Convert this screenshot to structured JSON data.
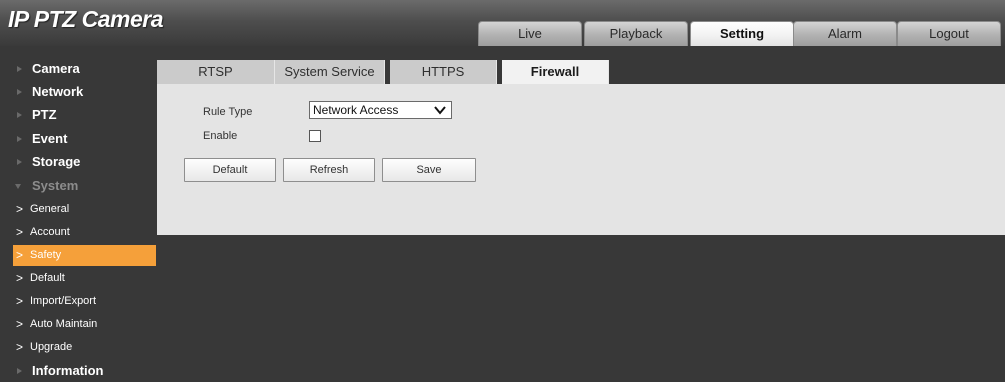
{
  "app": {
    "title": "IP PTZ Camera"
  },
  "top_tabs": [
    {
      "label": "Live",
      "active": false
    },
    {
      "label": "Playback",
      "active": false
    },
    {
      "label": "Setting",
      "active": true
    },
    {
      "label": "Alarm",
      "active": false
    },
    {
      "label": "Logout",
      "active": false
    }
  ],
  "sidebar": {
    "items": [
      {
        "label": "Camera",
        "icon": "triangle-right-icon"
      },
      {
        "label": "Network",
        "icon": "triangle-right-icon"
      },
      {
        "label": "PTZ",
        "icon": "triangle-right-icon"
      },
      {
        "label": "Event",
        "icon": "triangle-right-icon"
      },
      {
        "label": "Storage",
        "icon": "triangle-right-icon"
      },
      {
        "label": "System",
        "icon": "triangle-down-icon",
        "expanded": true
      },
      {
        "label": "Information",
        "icon": "triangle-right-icon"
      }
    ],
    "system_children": [
      {
        "label": "General",
        "active": false
      },
      {
        "label": "Account",
        "active": false
      },
      {
        "label": "Safety",
        "active": true
      },
      {
        "label": "Default",
        "active": false
      },
      {
        "label": "Import/Export",
        "active": false
      },
      {
        "label": "Auto Maintain",
        "active": false
      },
      {
        "label": "Upgrade",
        "active": false
      }
    ]
  },
  "sub_tabs": [
    {
      "label": "RTSP Authentication",
      "active": false
    },
    {
      "label": "System Service",
      "active": false
    },
    {
      "label": "HTTPS",
      "active": false
    },
    {
      "label": "Firewall",
      "active": true
    }
  ],
  "form": {
    "rule_type_label": "Rule Type",
    "rule_type_value": "Network Access",
    "enable_label": "Enable",
    "enable_checked": false
  },
  "buttons": {
    "default_label": "Default",
    "refresh_label": "Refresh",
    "save_label": "Save"
  },
  "colors": {
    "accent": "#f5a03a",
    "background": "#383838",
    "panel": "#e4e4e4"
  }
}
